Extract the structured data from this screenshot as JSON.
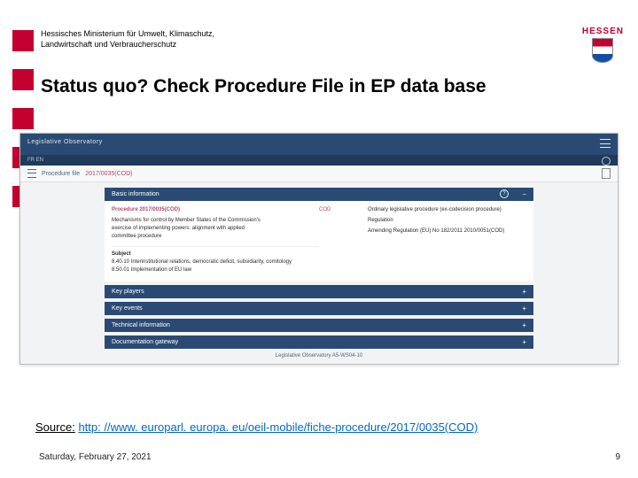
{
  "header": {
    "ministry_line1": "Hessisches Ministerium für Umwelt, Klimaschutz,",
    "ministry_line2": "Landwirtschaft und Verbraucherschutz",
    "logo_text": "HESSEN"
  },
  "slide": {
    "title": "Status quo? Check Procedure File in EP data base",
    "source_label": "Source:",
    "source_url": "http: //www. europarl. europa. eu/oeil-mobile/fiche-procedure/2017/0035(COD)",
    "date": "Saturday, February 27, 2021",
    "page_number": "9"
  },
  "ep": {
    "header_title": "Legislative Observatory",
    "langs": "FR  EN",
    "filebar_label": "Procedure file",
    "file_id": "2017/0035(COD)",
    "basic_info": "Basic information",
    "proc_ref": "Procedure 2017/0035(COD)",
    "proc_desc1": "Mechanisms for control by Member States of the Commission's",
    "proc_desc2": "exercise of implementing powers: alignment with applied",
    "proc_desc3": "committee procedure",
    "rhs": [
      {
        "k": "COD",
        "v": "Ordinary legislative procedure (ex-codecision procedure)"
      },
      {
        "k": "",
        "v": "Regulation"
      },
      {
        "k": "",
        "v": "Amending Regulation (EU) No 182/2011 2010/0051(COD)"
      }
    ],
    "subject_label": "Subject",
    "subject_1": "8.40.10 Interinstitutional relations, democratic deficit, subsidiarity, comitology",
    "subject_2": "8.50.01 Implementation of EU law",
    "sections": [
      "Key players",
      "Key events",
      "Technical information",
      "Documentation gateway"
    ],
    "footer": "Legislative Observatory   A5-WS04-10"
  }
}
